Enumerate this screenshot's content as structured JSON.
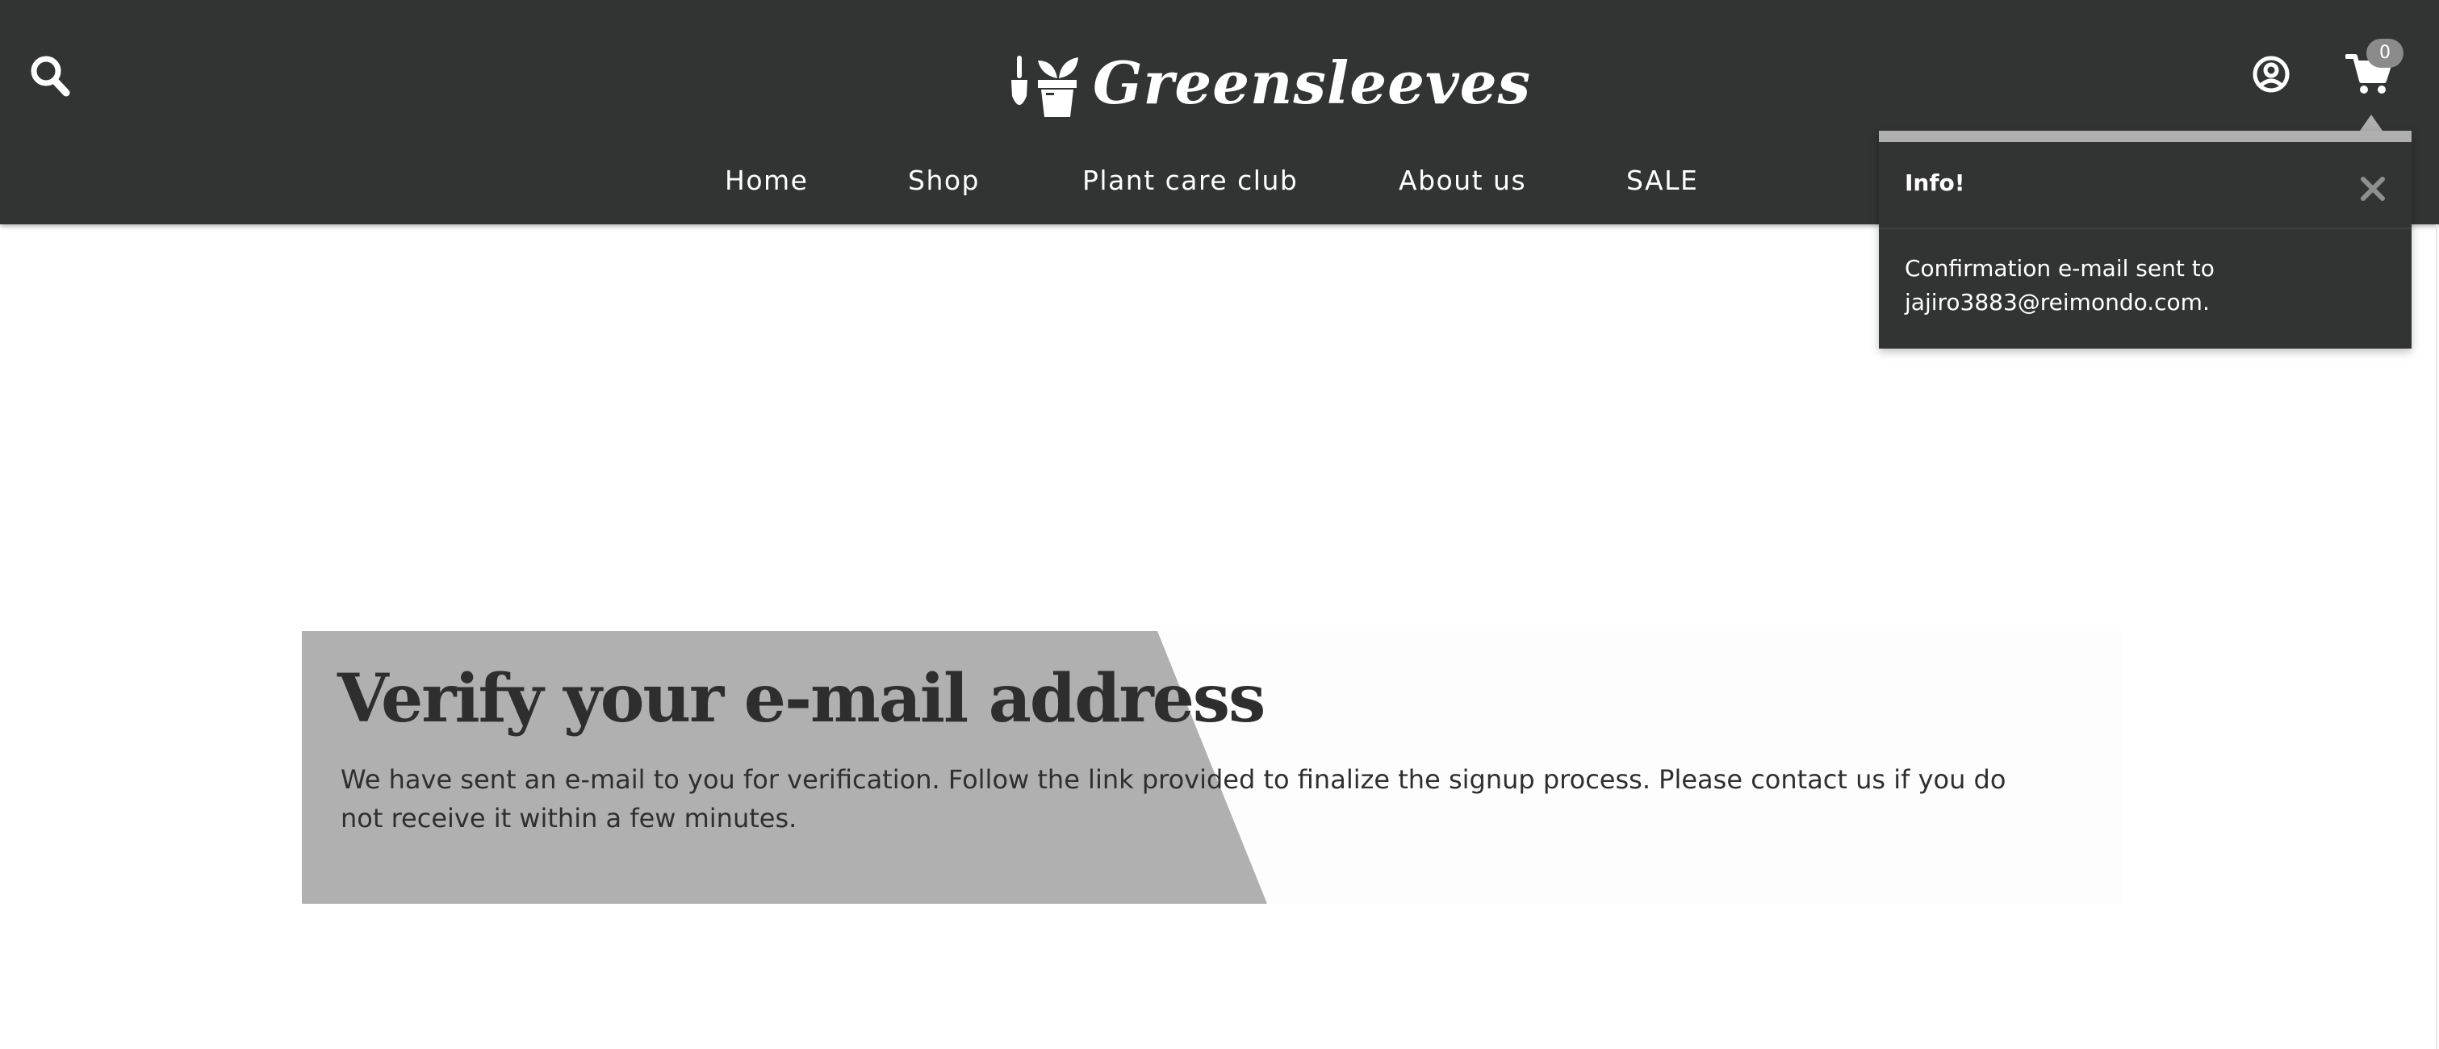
{
  "header": {
    "brand": "Greensleeves",
    "nav": [
      {
        "label": "Home"
      },
      {
        "label": "Shop"
      },
      {
        "label": "Plant care club"
      },
      {
        "label": "About us"
      },
      {
        "label": "SALE"
      }
    ],
    "cart_count": "0",
    "icons": {
      "search": "search-icon",
      "account": "user-circle-icon",
      "cart": "shopping-cart-icon"
    }
  },
  "notification": {
    "title": "Info!",
    "message": "Confirmation e-mail sent to jajiro3883@reimondo.com.",
    "close_icon": "close-icon"
  },
  "main": {
    "title": "Verify your e-mail address",
    "text": "We have sent an e-mail to you for verification. Follow the link provided to finalize the signup process. Please contact us if you do not receive it within a few minutes."
  },
  "colors": {
    "header_bg": "#323333",
    "accent_grey": "#b0afb0",
    "text_dark": "#2e2e2e",
    "white": "#ffffff"
  }
}
